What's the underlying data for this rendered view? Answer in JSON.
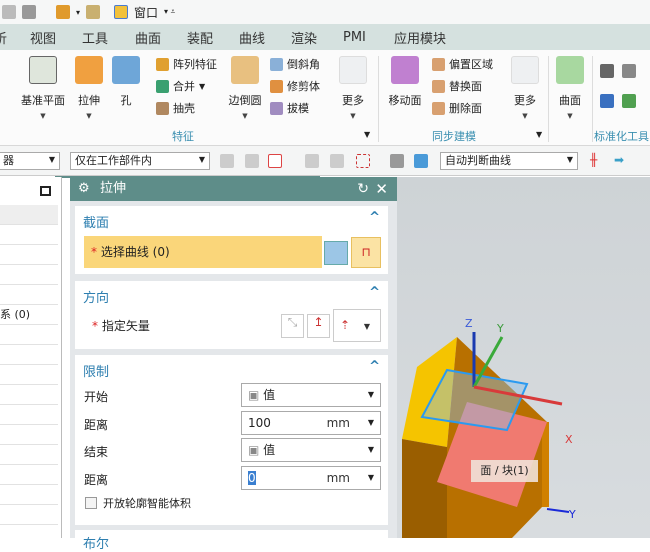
{
  "quick_access": {
    "window_menu": "窗口"
  },
  "menu_tabs": [
    "析",
    "视图",
    "工具",
    "曲面",
    "装配",
    "曲线",
    "渲染",
    "PMI",
    "应用模块"
  ],
  "ribbon": {
    "feature_group": {
      "label": "特征",
      "datum_plane": "基准平面",
      "extrude": "拉伸",
      "hole": "孔",
      "pattern_feature": "阵列特征",
      "unite": "合并",
      "shell": "抽壳",
      "edge_blend": "边倒圆",
      "chamfer": "倒斜角",
      "trim_body": "修剪体",
      "draft": "拔模",
      "more": "更多"
    },
    "sync_group": {
      "label": "同步建模",
      "move_face": "移动面",
      "offset_region": "偏置区域",
      "replace_face": "替换面",
      "delete_face": "删除面",
      "more": "更多"
    },
    "surface": "曲面",
    "standard_tools": {
      "label": "标准化工具"
    }
  },
  "toolbar": {
    "filter_partial": "器",
    "scope": "仅在工作部件内",
    "curve_rule": "自动判断曲线"
  },
  "left_panel": {
    "row_text": "系 (0)"
  },
  "dialog": {
    "title": "拉伸",
    "section": {
      "title": "截面",
      "select_curve": "选择曲线 (0)"
    },
    "direction": {
      "title": "方向",
      "specify_vector": "指定矢量"
    },
    "limits": {
      "title": "限制",
      "start_label": "开始",
      "start_value": "值",
      "distance1_label": "距离",
      "distance1_value": "100",
      "unit": "mm",
      "end_label": "结束",
      "end_value": "值",
      "distance2_label": "距离",
      "distance2_value": "0",
      "open_profile": "开放轮廓智能体积"
    },
    "boolean": {
      "title": "布尔"
    }
  },
  "viewport": {
    "tooltip": "面 / 块(1)",
    "axes": {
      "x": "X",
      "y": "Y",
      "z": "Z",
      "y2": "Y"
    }
  }
}
